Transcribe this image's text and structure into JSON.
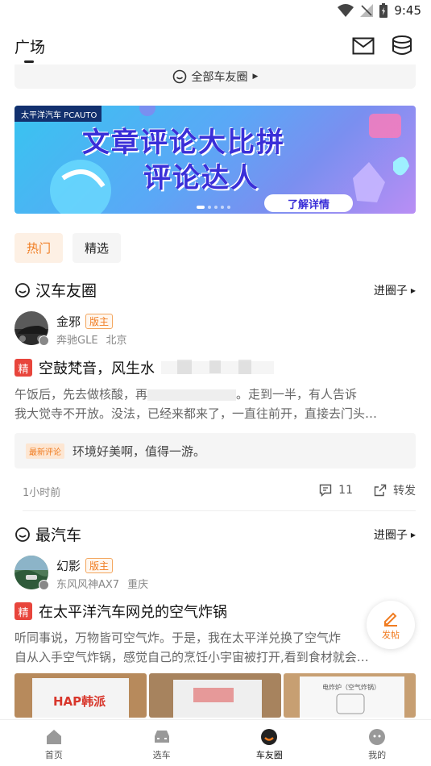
{
  "status_bar": {
    "time": "9:45"
  },
  "header": {
    "title": "广场",
    "icons": [
      "mail-icon",
      "coin-stack-icon"
    ]
  },
  "all_circles": {
    "label": "全部车友圈"
  },
  "banner": {
    "logo_text": "太平洋汽车 PCAUTO",
    "title_line1": "文章评论大比拼",
    "title_line2": "评论达人",
    "cta": "了解详情"
  },
  "tabs": [
    {
      "label": "热门",
      "active": true
    },
    {
      "label": "精选",
      "active": false
    }
  ],
  "feed": [
    {
      "circle_name": "汉车友圈",
      "enter_label": "进圈子",
      "author_name": "金邪",
      "author_tag": "版主",
      "car_model": "奔驰GLE",
      "city": "北京",
      "essence_tag": "精",
      "title": "空鼓梵音，风生水",
      "body_line1": "午饭后，先去做核酸，再",
      "body_line1_tail": "。走到一半，有人告诉",
      "body_line2": "我大觉寺不开放。没法，已经来都来了，一直往前开，直接去门头…",
      "comment_tag": "最新评论",
      "comment_text": "环境好美啊，值得一游。",
      "time": "1小时前",
      "comment_count": "11",
      "share_label": "转发"
    },
    {
      "circle_name": "最汽车",
      "enter_label": "进圈子",
      "author_name": "幻影",
      "author_tag": "版主",
      "car_model": "东风风神AX7",
      "city": "重庆",
      "essence_tag": "精",
      "title": "在太平洋汽车网兑的空气炸锅",
      "body_line1": "听同事说，万物皆可空气炸。于是，我在太平洋兑换了空气炸",
      "body_line2": "自从入手空气炸锅，感觉自己的烹饪小宇宙被打开,看到食材就会…",
      "image_labels": [
        "HAP韩派",
        "",
        "电炸炉（空气炸锅）"
      ]
    }
  ],
  "fab": {
    "label": "发帖"
  },
  "tabbar": [
    {
      "label": "首页",
      "icon": "home-icon",
      "active": false
    },
    {
      "label": "选车",
      "icon": "car-icon",
      "active": false
    },
    {
      "label": "车友圈",
      "icon": "circle-icon",
      "active": true
    },
    {
      "label": "我的",
      "icon": "profile-icon",
      "active": false
    }
  ],
  "colors": {
    "accent": "#f07c21",
    "essence": "#e8453c"
  }
}
